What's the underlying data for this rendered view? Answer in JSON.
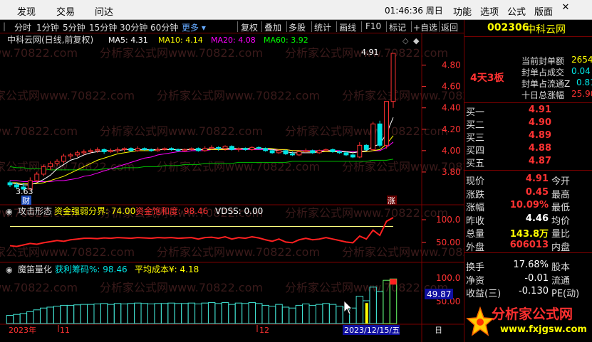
{
  "menu": {
    "left": [
      "发现",
      "交易",
      "问达"
    ],
    "clock": "01:46:36 周日",
    "right": [
      "功能",
      "选项",
      "公式",
      "版面"
    ],
    "close_glyph": "✕"
  },
  "toolbar": {
    "periods": [
      "分时",
      "1分钟",
      "5分钟",
      "15分钟",
      "30分钟",
      "60分钟"
    ],
    "more": "更多",
    "tools": [
      "复权",
      "叠加",
      "多股",
      "统计",
      "画线",
      "F10",
      "标记",
      "+自选",
      "返回"
    ]
  },
  "main": {
    "title": "中科云网(日线,前复权)",
    "ma": [
      {
        "label": "MA5: 4.31",
        "color": "#ffffff"
      },
      {
        "label": "MA10: 4.14",
        "color": "#ffff00"
      },
      {
        "label": "MA20: 4.08",
        "color": "#ff00ff"
      },
      {
        "label": "MA60: 3.92",
        "color": "#00ff00"
      }
    ],
    "y_ticks": [
      "4.80",
      "4.60",
      "4.40",
      "4.20",
      "4.00",
      "3.80"
    ],
    "high_label": "4.91",
    "low_label": "3.63",
    "cai_label": "财",
    "zhang_label": "涨",
    "watermark": "分析家公式网www.70822.com"
  },
  "ind1": {
    "name": "攻击形态",
    "items": [
      {
        "label": "资金强弱分界: 74.00",
        "color": "#ffff00"
      },
      {
        "label": "资金饱和度: 98.46",
        "color": "#ff3232"
      },
      {
        "label": "VDSS: 0.00",
        "color": "#ffffff"
      }
    ],
    "y_ticks": [
      "100.0",
      "50.00"
    ]
  },
  "ind2": {
    "name": "魔笛量化",
    "items": [
      {
        "label": "获利筹码%: 98.46",
        "color": "#00e6e6"
      },
      {
        "label": "平均成本¥: 4.18",
        "color": "#ffff00"
      }
    ],
    "y_ticks": [
      "100.0",
      "50.00"
    ],
    "cursor_value": "49.87"
  },
  "xaxis": {
    "labels": [
      "2023年",
      "11",
      "12"
    ],
    "date_box": "2023/12/15/五",
    "right_glyph": "日"
  },
  "panel": {
    "code": "002306",
    "name": "中科云网",
    "limit_label": "4天3板",
    "seal": [
      {
        "label": "当前封单额",
        "value": "2654"
      },
      {
        "label": "封单占成交",
        "value": "0.04"
      },
      {
        "label": "封单占流通Z",
        "value": "0.81"
      },
      {
        "label": "十日总涨幅",
        "value": "25.90"
      }
    ],
    "bids": [
      {
        "label": "买一",
        "price": "4.91"
      },
      {
        "label": "买二",
        "price": "4.90"
      },
      {
        "label": "买三",
        "price": "4.89"
      },
      {
        "label": "买四",
        "price": "4.88"
      },
      {
        "label": "买五",
        "price": "4.87"
      }
    ],
    "quote": [
      {
        "l1": "现价",
        "v": "4.91",
        "c": "red",
        "l2": "今开"
      },
      {
        "l1": "涨跌",
        "v": "0.45",
        "c": "red",
        "l2": "最高"
      },
      {
        "l1": "涨幅",
        "v": "10.09%",
        "c": "red",
        "l2": "最低"
      },
      {
        "l1": "昨收",
        "v": "4.46",
        "c": "white",
        "l2": "均价"
      },
      {
        "l1": "总量",
        "v": "143.8万",
        "c": "yellow",
        "l2": "量比"
      },
      {
        "l1": "外盘",
        "v": "606013",
        "c": "red",
        "l2": "内盘"
      }
    ],
    "quote2": [
      {
        "l1": "换手",
        "v": "17.68%",
        "c": "white",
        "l2": "股本"
      },
      {
        "l1": "净资",
        "v": "-0.01",
        "c": "white",
        "l2": "流通"
      },
      {
        "l1": "收益(三)",
        "v": "-0.130",
        "c": "white",
        "l2": "PE(动)"
      }
    ],
    "logo_text": "分析家公式网",
    "logo_url": "www.fxjgsw.com"
  },
  "chart_data": {
    "type": "candlestick",
    "candles": [
      [
        3.7,
        3.68,
        3.72,
        3.66
      ],
      [
        3.68,
        3.66,
        3.7,
        3.64
      ],
      [
        3.66,
        3.64,
        3.7,
        3.63
      ],
      [
        3.64,
        3.72,
        3.75,
        3.63
      ],
      [
        3.72,
        3.78,
        3.8,
        3.7
      ],
      [
        3.78,
        3.85,
        3.87,
        3.76
      ],
      [
        3.85,
        3.88,
        3.9,
        3.82
      ],
      [
        3.88,
        3.9,
        3.92,
        3.86
      ],
      [
        3.9,
        3.95,
        3.97,
        3.88
      ],
      [
        3.95,
        3.96,
        3.98,
        3.92
      ],
      [
        3.96,
        3.98,
        4.0,
        3.94
      ],
      [
        3.98,
        3.99,
        4.01,
        3.96
      ],
      [
        3.99,
        4.0,
        4.02,
        3.97
      ],
      [
        4.0,
        4.01,
        4.03,
        3.98
      ],
      [
        4.01,
        3.99,
        4.02,
        3.97
      ],
      [
        3.99,
        4.0,
        4.02,
        3.98
      ],
      [
        4.0,
        4.01,
        4.03,
        3.98
      ],
      [
        4.01,
        4.02,
        4.03,
        3.99
      ],
      [
        4.02,
        4.0,
        4.03,
        3.99
      ],
      [
        4.0,
        4.02,
        4.04,
        3.99
      ],
      [
        4.02,
        4.01,
        4.03,
        4.0
      ],
      [
        4.01,
        4.0,
        4.02,
        3.99
      ],
      [
        4.0,
        4.01,
        4.03,
        3.99
      ],
      [
        4.01,
        4.02,
        4.03,
        4.0
      ],
      [
        4.02,
        4.01,
        4.03,
        4.0
      ],
      [
        4.01,
        4.0,
        4.02,
        3.99
      ],
      [
        4.0,
        4.01,
        4.02,
        3.99
      ],
      [
        4.01,
        4.02,
        4.03,
        4.0
      ],
      [
        4.02,
        4.0,
        4.03,
        3.99
      ],
      [
        4.0,
        4.02,
        4.04,
        3.99
      ],
      [
        4.02,
        4.03,
        4.05,
        4.01
      ],
      [
        4.03,
        4.02,
        4.04,
        4.0
      ],
      [
        4.02,
        4.04,
        4.05,
        4.0
      ],
      [
        4.04,
        4.01,
        4.05,
        4.0
      ],
      [
        4.01,
        4.02,
        4.03,
        3.99
      ],
      [
        4.02,
        4.01,
        4.03,
        4.0
      ],
      [
        4.01,
        4.03,
        4.04,
        4.0
      ],
      [
        4.03,
        4.02,
        4.04,
        4.01
      ],
      [
        4.02,
        4.0,
        4.03,
        3.99
      ],
      [
        4.0,
        3.98,
        4.01,
        3.97
      ],
      [
        3.98,
        4.0,
        4.01,
        3.97
      ],
      [
        4.0,
        3.97,
        4.01,
        3.96
      ],
      [
        3.97,
        3.96,
        3.99,
        3.95
      ],
      [
        3.96,
        3.99,
        4.0,
        3.95
      ],
      [
        3.99,
        4.0,
        4.02,
        3.98
      ],
      [
        4.0,
        3.98,
        4.01,
        3.97
      ],
      [
        3.98,
        4.0,
        4.01,
        3.97
      ],
      [
        4.0,
        4.01,
        4.02,
        3.99
      ],
      [
        4.01,
        3.99,
        4.02,
        3.98
      ],
      [
        3.99,
        3.98,
        4.0,
        3.97
      ],
      [
        3.98,
        3.96,
        3.99,
        3.95
      ],
      [
        3.96,
        3.94,
        3.97,
        3.93
      ],
      [
        3.94,
        4.05,
        4.08,
        3.93
      ],
      [
        4.05,
        4.01,
        4.06,
        4.0
      ],
      [
        4.01,
        4.25,
        4.27,
        4.0
      ],
      [
        4.25,
        4.05,
        4.28,
        4.03
      ],
      [
        4.05,
        4.46,
        4.46,
        4.02
      ],
      [
        4.46,
        4.91,
        4.91,
        4.4
      ]
    ],
    "ma5": [
      3.7,
      3.69,
      3.68,
      3.68,
      3.7,
      3.73,
      3.77,
      3.83,
      3.87,
      3.91,
      3.93,
      3.96,
      3.98,
      3.99,
      4.0,
      4.0,
      4.0,
      4.01,
      4.01,
      4.01,
      4.01,
      4.01,
      4.01,
      4.01,
      4.01,
      4.01,
      4.01,
      4.01,
      4.01,
      4.01,
      4.02,
      4.02,
      4.02,
      4.02,
      4.02,
      4.02,
      4.02,
      4.02,
      4.02,
      4.01,
      4.0,
      3.99,
      3.98,
      3.98,
      3.98,
      3.98,
      3.99,
      4.0,
      4.0,
      3.99,
      3.99,
      3.98,
      3.99,
      4.0,
      4.04,
      4.06,
      4.16,
      4.31
    ],
    "ma10": [
      3.7,
      3.7,
      3.69,
      3.69,
      3.69,
      3.7,
      3.72,
      3.74,
      3.76,
      3.79,
      3.82,
      3.85,
      3.88,
      3.91,
      3.93,
      3.95,
      3.97,
      3.98,
      3.99,
      4.0,
      4.0,
      4.0,
      4.01,
      4.01,
      4.01,
      4.01,
      4.01,
      4.01,
      4.01,
      4.01,
      4.01,
      4.01,
      4.01,
      4.02,
      4.02,
      4.02,
      4.02,
      4.02,
      4.02,
      4.02,
      4.01,
      4.01,
      4.0,
      4.0,
      3.99,
      3.99,
      3.99,
      3.99,
      3.99,
      3.99,
      3.99,
      3.98,
      3.99,
      3.99,
      4.0,
      4.01,
      4.06,
      4.14
    ],
    "ma20": [
      3.72,
      3.72,
      3.71,
      3.71,
      3.71,
      3.71,
      3.71,
      3.72,
      3.72,
      3.73,
      3.74,
      3.76,
      3.77,
      3.79,
      3.81,
      3.83,
      3.85,
      3.87,
      3.89,
      3.91,
      3.93,
      3.94,
      3.96,
      3.97,
      3.98,
      3.99,
      3.99,
      4.0,
      4.0,
      4.0,
      4.01,
      4.01,
      4.01,
      4.01,
      4.01,
      4.01,
      4.01,
      4.01,
      4.01,
      4.01,
      4.01,
      4.01,
      4.0,
      4.0,
      4.0,
      4.0,
      4.0,
      4.0,
      4.0,
      4.0,
      3.99,
      3.99,
      3.99,
      3.99,
      4.0,
      4.0,
      4.03,
      4.08
    ],
    "ma60": [
      3.85,
      3.84,
      3.84,
      3.83,
      3.83,
      3.83,
      3.82,
      3.82,
      3.82,
      3.82,
      3.82,
      3.82,
      3.82,
      3.82,
      3.83,
      3.83,
      3.83,
      3.84,
      3.84,
      3.84,
      3.85,
      3.85,
      3.85,
      3.86,
      3.86,
      3.86,
      3.87,
      3.87,
      3.87,
      3.88,
      3.88,
      3.88,
      3.88,
      3.88,
      3.89,
      3.89,
      3.89,
      3.89,
      3.89,
      3.89,
      3.89,
      3.89,
      3.9,
      3.9,
      3.9,
      3.9,
      3.9,
      3.9,
      3.9,
      3.9,
      3.9,
      3.9,
      3.9,
      3.9,
      3.91,
      3.91,
      3.91,
      3.92
    ],
    "ind1_line": [
      22,
      20,
      24,
      28,
      26,
      30,
      33,
      36,
      34,
      38,
      40,
      42,
      42,
      41,
      43,
      42,
      44,
      43,
      42,
      44,
      43,
      42,
      44,
      43,
      44,
      42,
      43,
      44,
      40,
      44,
      45,
      42,
      46,
      40,
      44,
      42,
      46,
      43,
      38,
      34,
      40,
      32,
      30,
      38,
      42,
      38,
      40,
      44,
      40,
      36,
      32,
      30,
      48,
      40,
      64,
      50,
      88,
      98
    ],
    "ind1_threshold": 74,
    "ind2_bars": [
      18,
      20,
      22,
      26,
      30,
      34,
      36,
      38,
      40,
      40,
      41,
      42,
      42,
      43,
      44,
      42,
      44,
      43,
      44,
      45,
      44,
      43,
      44,
      44,
      45,
      44,
      44,
      45,
      43,
      45,
      46,
      44,
      46,
      42,
      45,
      44,
      46,
      44,
      40,
      38,
      42,
      36,
      34,
      40,
      43,
      40,
      42,
      44,
      42,
      38,
      36,
      34,
      60,
      50,
      80,
      70,
      95,
      98
    ],
    "ylim": [
      3.6,
      4.95
    ]
  }
}
